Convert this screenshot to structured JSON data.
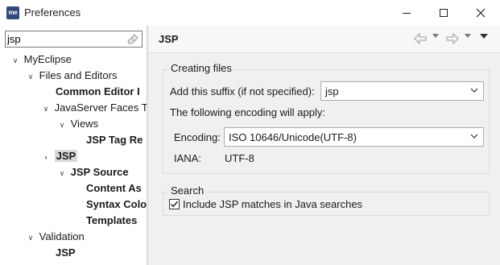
{
  "window": {
    "app_icon_text": "me",
    "title": "Preferences"
  },
  "left": {
    "filter_value": "jsp",
    "tree": [
      {
        "label": "MyEclipse",
        "arrow": "v"
      },
      {
        "label": "Files and Editors",
        "arrow": "v"
      },
      {
        "label": "Common Editor I",
        "arrow": ""
      },
      {
        "label": "JavaServer Faces T",
        "arrow": "v"
      },
      {
        "label": "Views",
        "arrow": "v"
      },
      {
        "label": "JSP Tag Re",
        "arrow": ""
      },
      {
        "label": "JSP",
        "arrow": ">"
      },
      {
        "label": "JSP Source",
        "arrow": "v"
      },
      {
        "label": "Content As",
        "arrow": ""
      },
      {
        "label": "Syntax Colo",
        "arrow": ""
      },
      {
        "label": "Templates",
        "arrow": ""
      },
      {
        "label": "Validation",
        "arrow": "v"
      },
      {
        "label": "JSP",
        "arrow": ""
      }
    ]
  },
  "page": {
    "title": "JSP",
    "creating_files": {
      "title": "Creating files",
      "suffix_label": "Add this suffix (if not specified):",
      "suffix_value": "jsp",
      "encoding_note": "The following encoding will apply:",
      "encoding_label": "Encoding:",
      "encoding_value": "ISO 10646/Unicode(UTF-8)",
      "iana_label": "IANA:",
      "iana_value": "UTF-8"
    },
    "search": {
      "title": "Search",
      "include_label": "Include JSP matches in Java searches",
      "include_checked": true
    }
  },
  "icons": {
    "back": "back-arrow-icon",
    "forward": "forward-arrow-icon",
    "menu": "view-menu-icon",
    "clear": "clear-filter-icon"
  }
}
